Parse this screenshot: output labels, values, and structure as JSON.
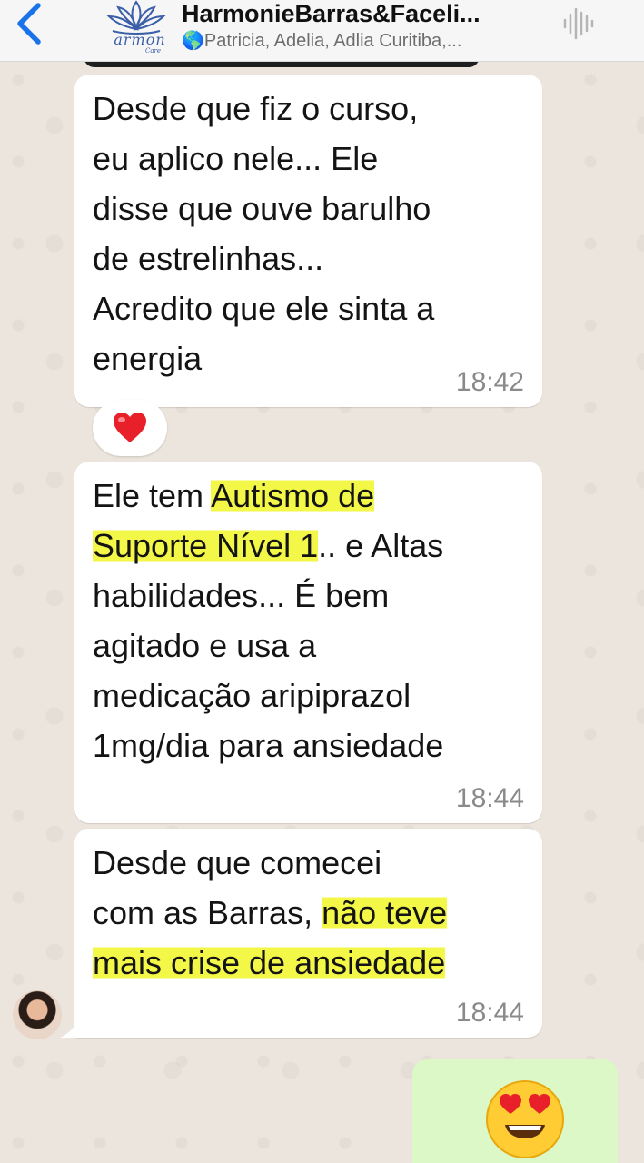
{
  "header": {
    "title": "HarmonieBarras&Faceli...",
    "subtitle": "🌎Patricia, Adelia, Adlia Curitiba,...",
    "logo_text": "armon",
    "logo_sub": "Care",
    "back_icon": "chevron-left-icon",
    "audio_icon": "waveform-icon"
  },
  "messages": [
    {
      "lines": [
        "Desde que fiz o curso,",
        "eu aplico nele... Ele",
        "disse que ouve barulho",
        "de estrelinhas...",
        "Acredito que ele sinta a",
        "energia"
      ],
      "time": "18:42",
      "reaction": "❤️"
    },
    {
      "parts": {
        "p1": "Ele tem ",
        "h1": "Autismo de",
        "h2": "Suporte Nível 1",
        "p2": ".. e Altas",
        "l3": "habilidades... É bem",
        "l4": "agitado e usa a",
        "l5": "medicação aripiprazol",
        "l6": "1mg/dia para ansiedade"
      },
      "time": "18:44"
    },
    {
      "parts": {
        "l1": "Desde que comecei",
        "p1": "com as Barras, ",
        "h1": "não teve",
        "h2": "mais crise de ansiedade"
      },
      "time": "18:44"
    }
  ],
  "outgoing": {
    "emoji": "smiling-face-with-heart-eyes"
  },
  "colors": {
    "highlight": "#f3f748",
    "outgoing_bubble": "#dcf8c6",
    "accent": "#1a73e8"
  }
}
